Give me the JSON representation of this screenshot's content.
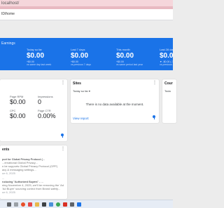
{
  "browser": {
    "url": "localhost/"
  },
  "app": {
    "url_fragment": "ID/home"
  },
  "earnings": {
    "heading": "Earnings",
    "metrics": [
      {
        "label": "Today so far",
        "value": "$0.00",
        "change": "+$0.00",
        "compare": "vs same day last week"
      },
      {
        "label": "Last 7 days",
        "value": "$0.00",
        "change": "+$0.00",
        "compare": "vs previous 7 days"
      },
      {
        "label": "This month",
        "value": "$0.00",
        "change": "+$0.00",
        "compare": "vs same period last year"
      },
      {
        "label": "Last 28 days",
        "value": "$0.00",
        "change": "▼ -$0.00 (-?",
        "compare": "vs previous 28"
      }
    ]
  },
  "performance": {
    "items": [
      {
        "label": "Page RPM",
        "value": "$0.00"
      },
      {
        "label": "Impressions",
        "value": "0"
      },
      {
        "label": "CPC",
        "value": "$0.00"
      },
      {
        "label": "Page CTR",
        "value": "0.00%"
      }
    ]
  },
  "sites": {
    "title": "Sites",
    "subtitle": "Today so far ▾",
    "empty_message": "There is no data available at the moment.",
    "view_report": "View report"
  },
  "countries": {
    "title": "Cour",
    "subtitle": "Toda"
  },
  "alerts": {
    "title": "ents",
    "lines": [
      {
        "text": "port for Global Privacy Protocol (...",
        "kind": "title"
      },
      {
        "text": "...ernational Global Privacy...",
        "kind": "body"
      },
      {
        "text": "n be supports Global Privacy Protocol (GPP)",
        "kind": "body"
      },
      {
        "text": "acy & messaging settings...",
        "kind": "body"
      },
      {
        "text": "ue 6, 2025",
        "kind": "date"
      },
      {
        "text": "...",
        "kind": "body"
      },
      {
        "text": "roducing \"Authorized Buyers\" - ...",
        "kind": "title"
      },
      {
        "text": "ning November 4, 2025, we'll be removing the 'Ad",
        "kind": "body"
      },
      {
        "text": "'Ad Buyer' sourcing control from Brand safety...",
        "kind": "body"
      },
      {
        "text": "ue 6, 2025",
        "kind": "date"
      }
    ]
  },
  "menu_icon": "⋮",
  "taskbar": {
    "icons": [
      {
        "name": "start-icon",
        "color": "#5f6368"
      },
      {
        "name": "search-icon",
        "color": "#9aa0a6"
      },
      {
        "name": "brave-icon",
        "color": "#e8502a"
      },
      {
        "name": "vivaldi-icon",
        "color": "#e54848"
      },
      {
        "name": "file-explorer-icon",
        "color": "#e8b84a"
      },
      {
        "name": "terminal-icon",
        "color": "#3c4043"
      },
      {
        "name": "store-icon",
        "color": "#4a90d9"
      },
      {
        "name": "chrome-icon",
        "color": "#3aa757"
      },
      {
        "name": "app-icon-1",
        "color": "#d93025"
      },
      {
        "name": "app-icon-2",
        "color": "#5f6368"
      },
      {
        "name": "app-icon-3",
        "color": "#1a73e8"
      }
    ]
  }
}
